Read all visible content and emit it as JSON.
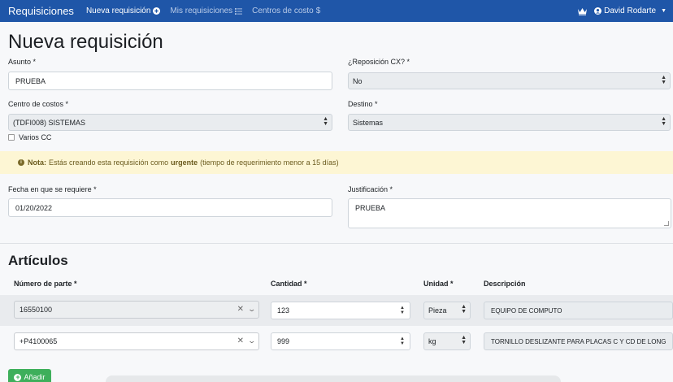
{
  "navbar": {
    "brand": "Requisiciones",
    "items": [
      {
        "label": "Nueva requisición",
        "icon": "plus-circle-icon",
        "active": true
      },
      {
        "label": "Mis requisiciones",
        "icon": "list-icon",
        "active": false
      },
      {
        "label": "Centros de costo",
        "icon": "dollar-icon",
        "active": false
      }
    ],
    "user": "David Rodarte",
    "crown_icon": "crown-icon"
  },
  "page": {
    "title": "Nueva requisición"
  },
  "form": {
    "asunto_label": "Asunto *",
    "asunto_value": "PRUEBA",
    "reposicion_label": "¿Reposición CX? *",
    "reposicion_value": "No",
    "centro_label": "Centro de costos *",
    "centro_value": "(TDFI008) SISTEMAS",
    "destino_label": "Destino *",
    "destino_value": "Sistemas",
    "varios_cc_label": "Varios CC",
    "fecha_label": "Fecha en que se requiere *",
    "fecha_value": "01/20/2022",
    "justificacion_label": "Justificación *",
    "justificacion_value": "PRUEBA"
  },
  "alert": {
    "icon": "info-icon",
    "note": "Nota:",
    "text_before": "Estás creando esta requisición como",
    "urgent": "urgente",
    "text_after": "(tiempo de requerimiento menor a 15 días)"
  },
  "articulos": {
    "title": "Artículos",
    "headers": {
      "part": "Número de parte *",
      "qty": "Cantidad *",
      "unit": "Unidad *",
      "desc": "Descripción"
    },
    "rows": [
      {
        "part": "16550100",
        "qty": "123",
        "unit": "Pieza",
        "desc": "EQUIPO DE COMPUTO"
      },
      {
        "part": "+P4100065",
        "qty": "999",
        "unit": "kg",
        "desc": "TORNILLO DESLIZANTE PARA PLACAS C Y CD DE LONG"
      }
    ],
    "add_label": "Añadir"
  },
  "colors": {
    "navbar": "#1f56a8",
    "alert_bg": "#fdf6d4",
    "add_button": "#3eaf5b"
  }
}
